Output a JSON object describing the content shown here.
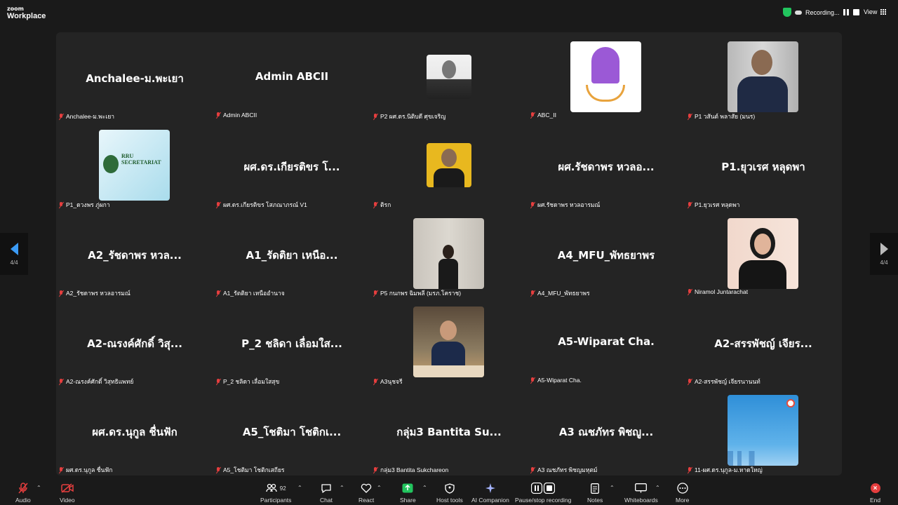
{
  "app": {
    "brand_top": "zoom",
    "brand_bottom": "Workplace"
  },
  "status": {
    "recording_label": "Recording...",
    "view_label": "View"
  },
  "pager": {
    "left_label": "4/4",
    "right_label": "4/4"
  },
  "tiles": [
    {
      "name": "Anchalee-ม.พะเยา",
      "label": "Anchalee-ม.พะเยา"
    },
    {
      "name": "Admin ABCII",
      "label": "Admin ABCII"
    },
    {
      "name": "",
      "label": "P2 ผศ.ดร.นิติบดี ศุขเจริญ"
    },
    {
      "name": "",
      "label": "ABC_II"
    },
    {
      "name": "",
      "label": "P1 วสันต์ พลาสัย (มนร)"
    },
    {
      "name": "",
      "label": "P1_ดวงพร ภู่ผกา"
    },
    {
      "name": "ผศ.ดร.เกียรติขร โ...",
      "label": "ผศ.ดร.เกียรติขร โสภณาภรณ์ V1"
    },
    {
      "name": "",
      "label": "ติรก"
    },
    {
      "name": "ผศ.รัชดาพร หวลอ...",
      "label": "ผศ.รัชดาพร หวลอารมณ์"
    },
    {
      "name": "P1.ยุวเรศ หลุดพา",
      "label": "P1.ยุวเรศ หลุดพา"
    },
    {
      "name": "A2_รัชดาพร หวล...",
      "label": "A2_รัชดาพร หวลอารมณ์"
    },
    {
      "name": "A1_รัดติยา เหนือ...",
      "label": "A1_รัตติยา เหนืออำนาจ"
    },
    {
      "name": "",
      "label": "P5 กนกพร ฉิมพลี (มรภ.โคราช)"
    },
    {
      "name": "A4_MFU_พัทธยาพร",
      "label": "A4_MFU_พัทธยาพร"
    },
    {
      "name": "",
      "label": "Niramol Juntarachat"
    },
    {
      "name": "A2-ณรงค์ศักดิ์ วิสุ...",
      "label": "A2-ณรงค์ศักดิ์ วิสุทธิแพทย์"
    },
    {
      "name": "P_2 ชลิดา เลื่อมใส...",
      "label": "P_2 ชลิดา เลื่อมใสสุข"
    },
    {
      "name": "",
      "label": "A3นุชจรี"
    },
    {
      "name": "A5-Wiparat Cha.",
      "label": "A5-Wiparat Cha."
    },
    {
      "name": "A2-สรรพัชญ์ เจียร...",
      "label": "A2-สรรพัชญ์ เจียรนานนท์"
    },
    {
      "name": "ผศ.ดร.นุกูล ชื่นฟัก",
      "label": "ผศ.ดร.นุกูล ชื่นฟัก"
    },
    {
      "name": "A5_โชติมา โชติกเ...",
      "label": "A5_โชติมา โชติกเสถียร"
    },
    {
      "name": "กลุ่ม3 Bantita Su...",
      "label": "กลุ่ม3 Bantita Sukchareon"
    },
    {
      "name": "A3 ณชภัทร พิชญู...",
      "label": "A3 ณชภัทร พิชญมหุตม์"
    },
    {
      "name": "",
      "label": "11-ผศ.ดร.นุกูล-ม.หาดใหญ่"
    }
  ],
  "toolbar": {
    "audio": "Audio",
    "video": "Video",
    "participants": "Participants",
    "participants_count": "92",
    "chat": "Chat",
    "react": "React",
    "share": "Share",
    "host_tools": "Host tools",
    "ai_companion": "AI Companion",
    "pause_recording": "Pause/stop recording",
    "notes": "Notes",
    "whiteboards": "Whiteboards",
    "more": "More",
    "end": "End"
  }
}
